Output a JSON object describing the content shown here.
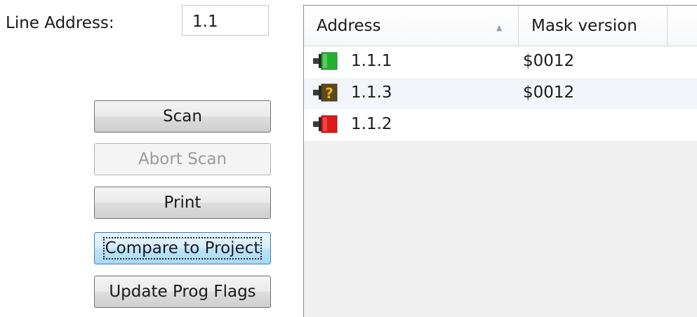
{
  "line_address": {
    "label": "Line Address:",
    "value": "1.1"
  },
  "buttons": {
    "scan": "Scan",
    "abort_scan": "Abort Scan",
    "print": "Print",
    "compare_to_project": "Compare to Project",
    "update_prog_flags": "Update Prog Flags"
  },
  "device_list": {
    "columns": [
      "Address",
      "Mask version"
    ],
    "sort_column": "Address",
    "sort_direction": "ascending",
    "rows": [
      {
        "address": "1.1.1",
        "mask_version": "$0012",
        "status_icon": "device-ok-icon",
        "status_color": "#22b030"
      },
      {
        "address": "1.1.3",
        "mask_version": "$0012",
        "status_icon": "device-unknown-icon",
        "status_color": "#e0a000"
      },
      {
        "address": "1.1.2",
        "mask_version": "",
        "status_icon": "device-error-icon",
        "status_color": "#dd1a1a"
      }
    ]
  },
  "colors": {
    "focus_button": "#a7d9f5",
    "row_alt": "#f2f6fb"
  }
}
